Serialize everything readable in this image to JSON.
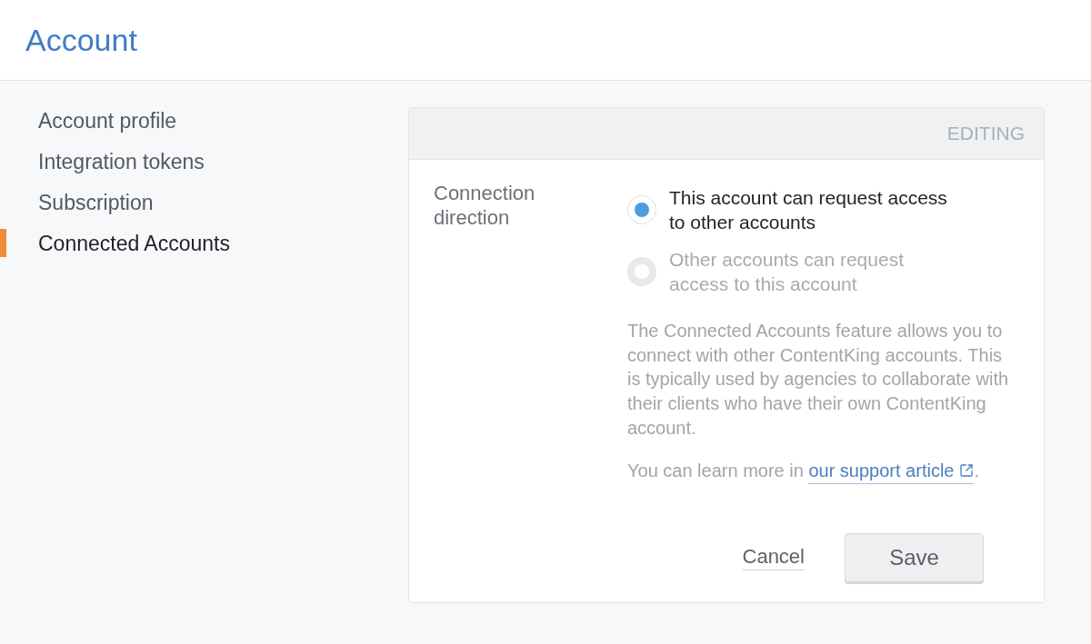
{
  "header": {
    "title": "Account"
  },
  "sidebar": {
    "items": [
      {
        "label": "Account profile",
        "selected": false
      },
      {
        "label": "Integration tokens",
        "selected": false
      },
      {
        "label": "Subscription",
        "selected": false
      },
      {
        "label": "Connected Accounts",
        "selected": true
      }
    ]
  },
  "panel": {
    "status": "EDITING",
    "field": {
      "label": "Connection direction",
      "options": [
        {
          "label": "This account can request access to other accounts",
          "selected": true,
          "disabled": false
        },
        {
          "label": "Other accounts can request access to this account",
          "selected": false,
          "disabled": true
        }
      ]
    },
    "description": "The Connected Accounts feature allows you to connect with other ContentKing accounts. This is typically used by agencies to collaborate with their clients who have their own ContentKing account.",
    "learn_more": {
      "text": "You can learn more in",
      "link": "our support article",
      "end": "."
    },
    "buttons": [
      {
        "kind": "link",
        "label": "Cancel"
      },
      {
        "kind": "primary",
        "label": "Save"
      }
    ]
  }
}
